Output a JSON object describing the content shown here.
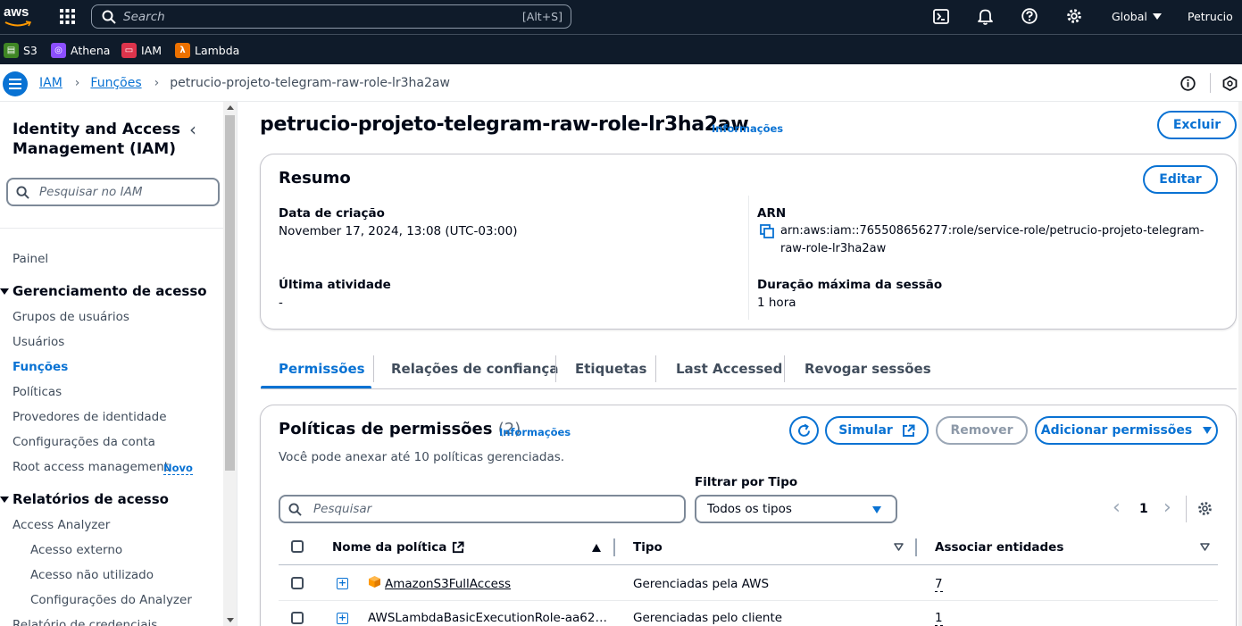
{
  "topnav": {
    "logo": "aws",
    "search_placeholder": "Search",
    "search_shortcut": "[Alt+S]",
    "region": "Global",
    "user": "Petrucio",
    "icons": [
      "services-grid-icon",
      "search-icon",
      "cloudshell-icon",
      "bell-icon",
      "help-icon",
      "gear-icon"
    ]
  },
  "favorites": [
    {
      "label": "S3",
      "color": "#3f8624"
    },
    {
      "label": "Athena",
      "color": "#8c4fff"
    },
    {
      "label": "IAM",
      "color": "#dd344c"
    },
    {
      "label": "Lambda",
      "color": "#ed7100"
    }
  ],
  "breadcrumb": {
    "items": [
      "IAM",
      "Funções"
    ],
    "current": "petrucio-projeto-telegram-raw-role-lr3ha2aw"
  },
  "sidebar": {
    "title": "Identity and Access Management (IAM)",
    "search_placeholder": "Pesquisar no IAM",
    "painel": "Painel",
    "sections": [
      {
        "title": "Gerenciamento de acesso",
        "items": [
          "Grupos de usuários",
          "Usuários",
          "Funções",
          "Políticas",
          "Provedores de identidade",
          "Configurações da conta",
          "Root access management"
        ],
        "active": "Funções",
        "badge": "Novo"
      },
      {
        "title": "Relatórios de acesso",
        "items": [
          "Access Analyzer"
        ],
        "subitems": [
          "Acesso externo",
          "Acesso não utilizado",
          "Configurações do Analyzer"
        ],
        "next_item": "Relatório de credenciais"
      }
    ]
  },
  "page": {
    "title": "petrucio-projeto-telegram-raw-role-lr3ha2aw",
    "info": "Informações",
    "delete_label": "Excluir"
  },
  "summary": {
    "title": "Resumo",
    "edit_label": "Editar",
    "created_label": "Data de criação",
    "created_value": "November 17, 2024, 13:08 (UTC-03:00)",
    "last_activity_label": "Última atividade",
    "last_activity_value": "-",
    "arn_label": "ARN",
    "arn_line1": "arn:aws:iam::765508656277:role/service-role/petrucio-projeto-telegram-",
    "arn_line2": "raw-role-lr3ha2aw",
    "session_label": "Duração máxima da sessão",
    "session_value": "1 hora"
  },
  "tabs": [
    "Permissões",
    "Relações de confiança",
    "Etiquetas",
    "Last Accessed",
    "Revogar sessões"
  ],
  "active_tab": "Permissões",
  "policies": {
    "title": "Políticas de permissões",
    "count": "(2)",
    "info": "Informações",
    "subtitle": "Você pode anexar até 10 políticas gerenciadas.",
    "simulate_label": "Simular",
    "remove_label": "Remover",
    "add_label": "Adicionar permissões",
    "search_placeholder": "Pesquisar",
    "filter_label": "Filtrar por Tipo",
    "filter_value": "Todos os tipos",
    "page": "1",
    "columns": [
      "Nome da política",
      "Tipo",
      "Associar entidades"
    ],
    "rows": [
      {
        "name": "AmazonS3FullAccess",
        "type": "Gerenciadas pela AWS",
        "entities": "7"
      },
      {
        "name": "AWSLambdaBasicExecutionRole-aa62…",
        "type": "Gerenciadas pelo cliente",
        "entities": "1"
      }
    ]
  }
}
